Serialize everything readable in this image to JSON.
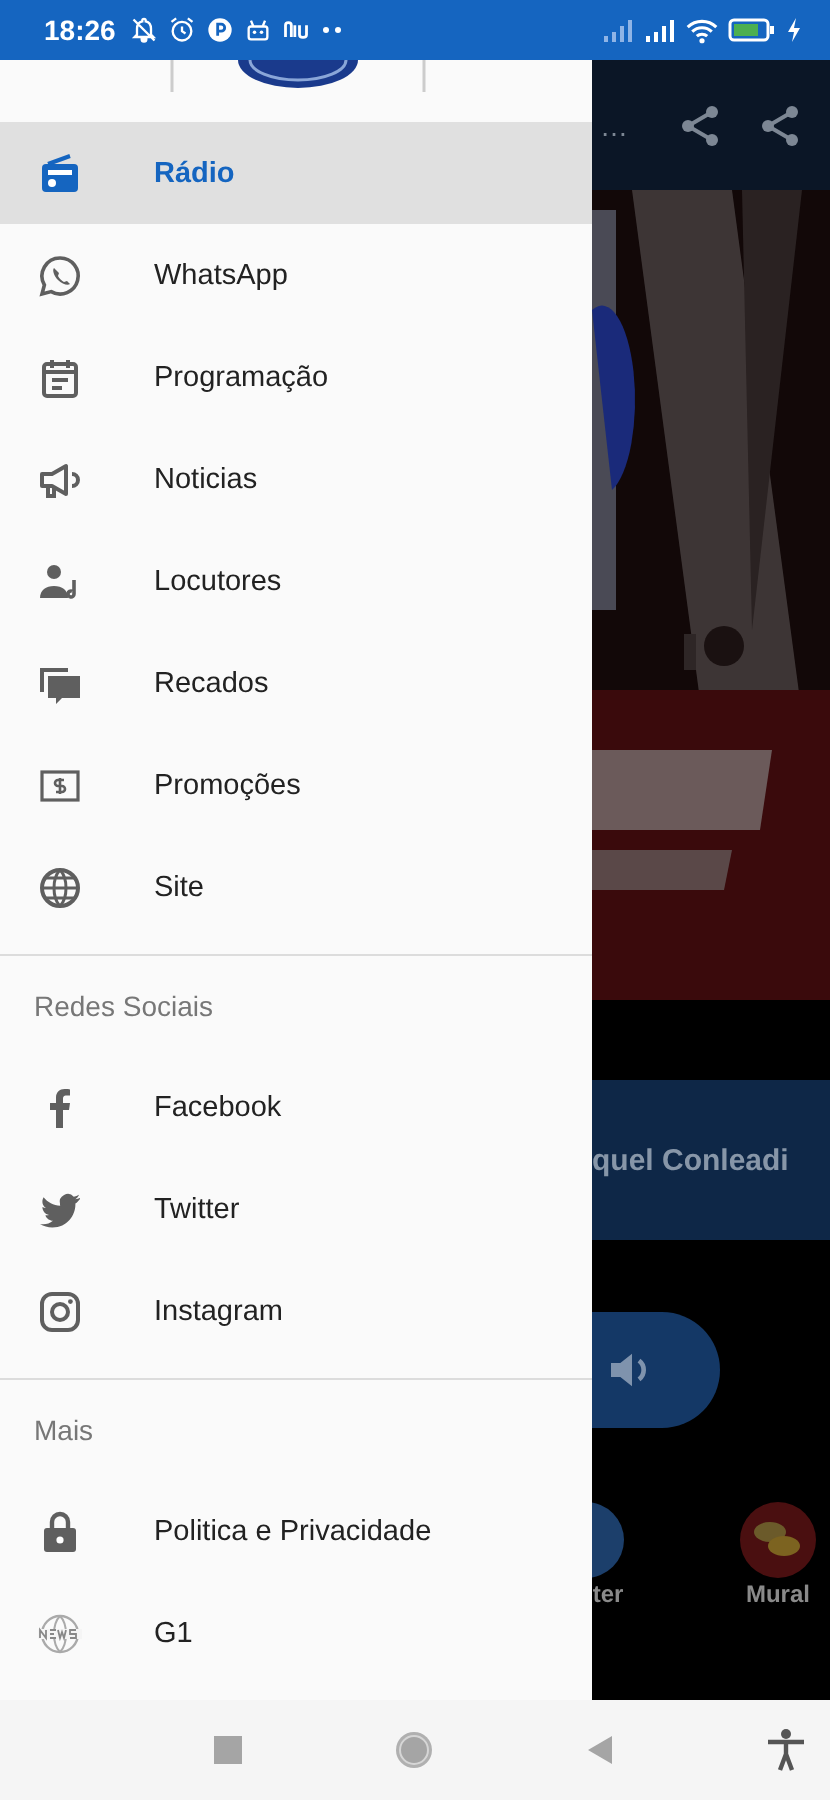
{
  "status_bar": {
    "time": "18:26"
  },
  "drawer": {
    "sections": [
      {
        "items": [
          {
            "kind": "radio",
            "label": "Rádio",
            "selected": true
          },
          {
            "kind": "whatsapp",
            "label": "WhatsApp",
            "selected": false
          },
          {
            "kind": "calendar",
            "label": "Programação",
            "selected": false
          },
          {
            "kind": "megaphone",
            "label": "Noticias",
            "selected": false
          },
          {
            "kind": "people",
            "label": "Locutores",
            "selected": false
          },
          {
            "kind": "chat",
            "label": "Recados",
            "selected": false
          },
          {
            "kind": "money",
            "label": "Promoções",
            "selected": false
          },
          {
            "kind": "globe",
            "label": "Site",
            "selected": false
          }
        ]
      },
      {
        "title": "Redes Sociais",
        "items": [
          {
            "kind": "facebook",
            "label": "Facebook",
            "selected": false
          },
          {
            "kind": "twitter",
            "label": "Twitter",
            "selected": false
          },
          {
            "kind": "instagram",
            "label": "Instagram",
            "selected": false
          }
        ]
      },
      {
        "title": "Mais",
        "items": [
          {
            "kind": "lock",
            "label": "Politica e Privacidade",
            "selected": false
          },
          {
            "kind": "news",
            "label": "G1",
            "selected": false
          }
        ]
      }
    ]
  },
  "app": {
    "title": "…",
    "now_playing": "quel Conleadi",
    "bottom_nav": [
      {
        "kind": "blue",
        "label": "ter"
      },
      {
        "kind": "mural",
        "label": "Mural"
      }
    ]
  }
}
